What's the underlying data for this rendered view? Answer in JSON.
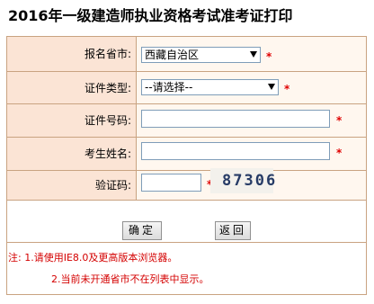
{
  "page_title": "2016年一级建造师执业资格考试准考证打印",
  "form": {
    "province_label": "报名省市:",
    "province_value": "西藏自治区",
    "id_type_label": "证件类型:",
    "id_type_value": "--请选择--",
    "id_number_label": "证件号码:",
    "name_label": "考生姓名:",
    "captcha_label": "验证码:",
    "captcha_text": "87306",
    "required_mark": "*"
  },
  "buttons": {
    "confirm_label": "确定",
    "back_label": "返回"
  },
  "notes": {
    "line1": "注: 1.请使用IE8.0及更高版本浏览器。",
    "line2": "2.当前未开通省市不在列表中显示。"
  },
  "colors": {
    "label_bg": "#fbe4d5",
    "field_bg": "#fff7ef",
    "border": "#c9a381",
    "required": "#e00000"
  }
}
